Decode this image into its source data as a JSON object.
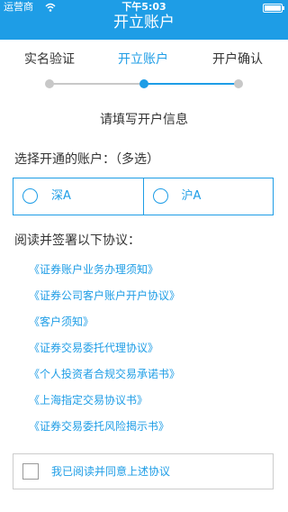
{
  "status_bar": {
    "carrier": "运营商",
    "time": "下午5:03"
  },
  "header": {
    "title": "开立账户"
  },
  "steps": [
    {
      "label": "实名验证",
      "active": false
    },
    {
      "label": "开立账户",
      "active": true
    },
    {
      "label": "开户确认",
      "active": false
    }
  ],
  "form": {
    "heading": "请填写开户信息",
    "account_section_label": "选择开通的账户：（多选）",
    "account_options": [
      {
        "label": "深A",
        "checked": false
      },
      {
        "label": "沪A",
        "checked": false
      }
    ],
    "agreements_label": "阅读并签署以下协议：",
    "agreements": [
      "《证券账户业务办理须知》",
      "《证券公司客户账户开户协议》",
      "《客户须知》",
      "《证券交易委托代理协议》",
      "《个人投资者合规交易承诺书》",
      "《上海指定交易协议书》",
      "《证券交易委托风险揭示书》"
    ],
    "confirm_label": "我已阅读并同意上述协议",
    "confirm_checked": false
  },
  "colors": {
    "accent": "#1e9de6",
    "inactive": "#c8c8c8"
  }
}
